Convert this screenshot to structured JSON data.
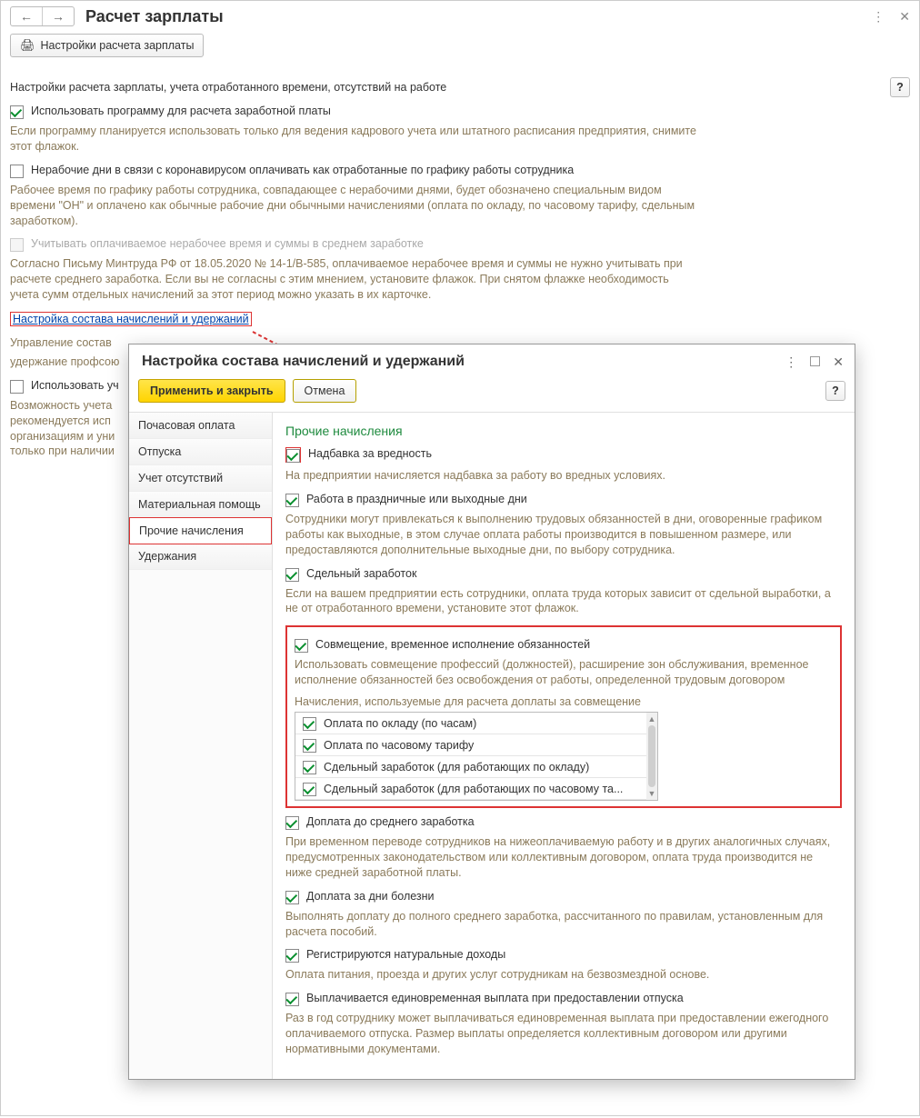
{
  "main": {
    "title": "Расчет зарплаты",
    "settings_btn": "Настройки расчета зарплаты",
    "section_title": "Настройки расчета зарплаты, учета отработанного времени, отсутствий на работе",
    "opt1_label": "Использовать программу для расчета заработной платы",
    "opt1_desc": "Если программу планируется использовать только для ведения кадрового учета или штатного расписания предприятия, снимите этот флажок.",
    "opt2_label": "Нерабочие дни в связи с коронавирусом оплачивать как отработанные по графику работы сотрудника",
    "opt2_desc": "Рабочее время по графику работы сотрудника, совпадающее с нерабочими днями, будет обозначено специальным видом времени \"ОН\" и оплачено как обычные рабочие дни обычными начислениями (оплата по окладу, по часовому тарифу, сдельным заработком).",
    "opt3_label": "Учитывать оплачиваемое нерабочее время и суммы в среднем заработке",
    "opt3_desc": "Согласно Письму Минтруда РФ от 18.05.2020 № 14-1/В-585, оплачиваемое нерабочее время и суммы не нужно учитывать при расчете среднего заработка. Если вы не согласны с этим мнением, установите флажок. При снятом флажке необходимость учета сумм отдельных начислений за этот период можно указать в их карточке.",
    "link": "Настройка состава начислений и удержаний",
    "para1": "Управление состав",
    "para2": "удержание профсою",
    "opt4_label": "Использовать уч",
    "opt4_desc": "Возможность учета\nрекомендуется исп\nорганизациям и уни\nтолько при наличии"
  },
  "dialog": {
    "title": "Настройка состава начислений и удержаний",
    "apply": "Применить и закрыть",
    "cancel": "Отмена",
    "side": {
      "i0": "Почасовая оплата",
      "i1": "Отпуска",
      "i2": "Учет отсутствий",
      "i3": "Материальная помощь",
      "i4": "Прочие начисления",
      "i5": "Удержания"
    },
    "content_h": "Прочие начисления",
    "o1_label": "Надбавка за вредность",
    "o1_desc": "На предприятии начисляется надбавка за работу во вредных условиях.",
    "o2_label": "Работа в праздничные или выходные дни",
    "o2_desc": "Сотрудники могут привлекаться к выполнению трудовых обязанностей в дни, оговоренные графиком работы как выходные, в этом случае оплата работы производится в повышенном размере, или предоставляются дополнительные выходные дни, по выбору сотрудника.",
    "o3_label": "Сдельный заработок",
    "o3_desc": "Если на вашем предприятии есть сотрудники, оплата труда которых зависит от сдельной выработки, а не от отработанного времени, установите этот флажок.",
    "o4_label": "Совмещение, временное исполнение обязанностей",
    "o4_desc": "Использовать совмещение профессий (должностей), расширение зон обслуживания, временное исполнение обязанностей без освобождения от работы, определенной трудовым договором",
    "o4_sub": "Начисления, используемые для расчета доплаты за совмещение",
    "list": {
      "r0": "Оплата по окладу (по часам)",
      "r1": "Оплата по часовому тарифу",
      "r2": "Сдельный заработок (для работающих по окладу)",
      "r3": "Сдельный заработок (для работающих по часовому та..."
    },
    "o5_label": "Доплата до среднего заработка",
    "o5_desc": "При временном переводе сотрудников на нижеоплачиваемую работу и в других аналогичных случаях, предусмотренных законодательством или коллективным договором, оплата труда производится не ниже средней заработной платы.",
    "o6_label": "Доплата за дни болезни",
    "o6_desc": "Выполнять доплату до полного среднего заработка, рассчитанного по правилам, установленным для расчета пособий.",
    "o7_label": "Регистрируются натуральные доходы",
    "o7_desc": "Оплата питания, проезда и других услуг сотрудникам на безвозмездной основе.",
    "o8_label": "Выплачивается единовременная выплата при предоставлении отпуска",
    "o8_desc": "Раз в год сотруднику может выплачиваться единовременная выплата при предоставлении ежегодного оплачиваемого отпуска. Размер выплаты определяется коллективным договором или другими нормативными документами."
  }
}
